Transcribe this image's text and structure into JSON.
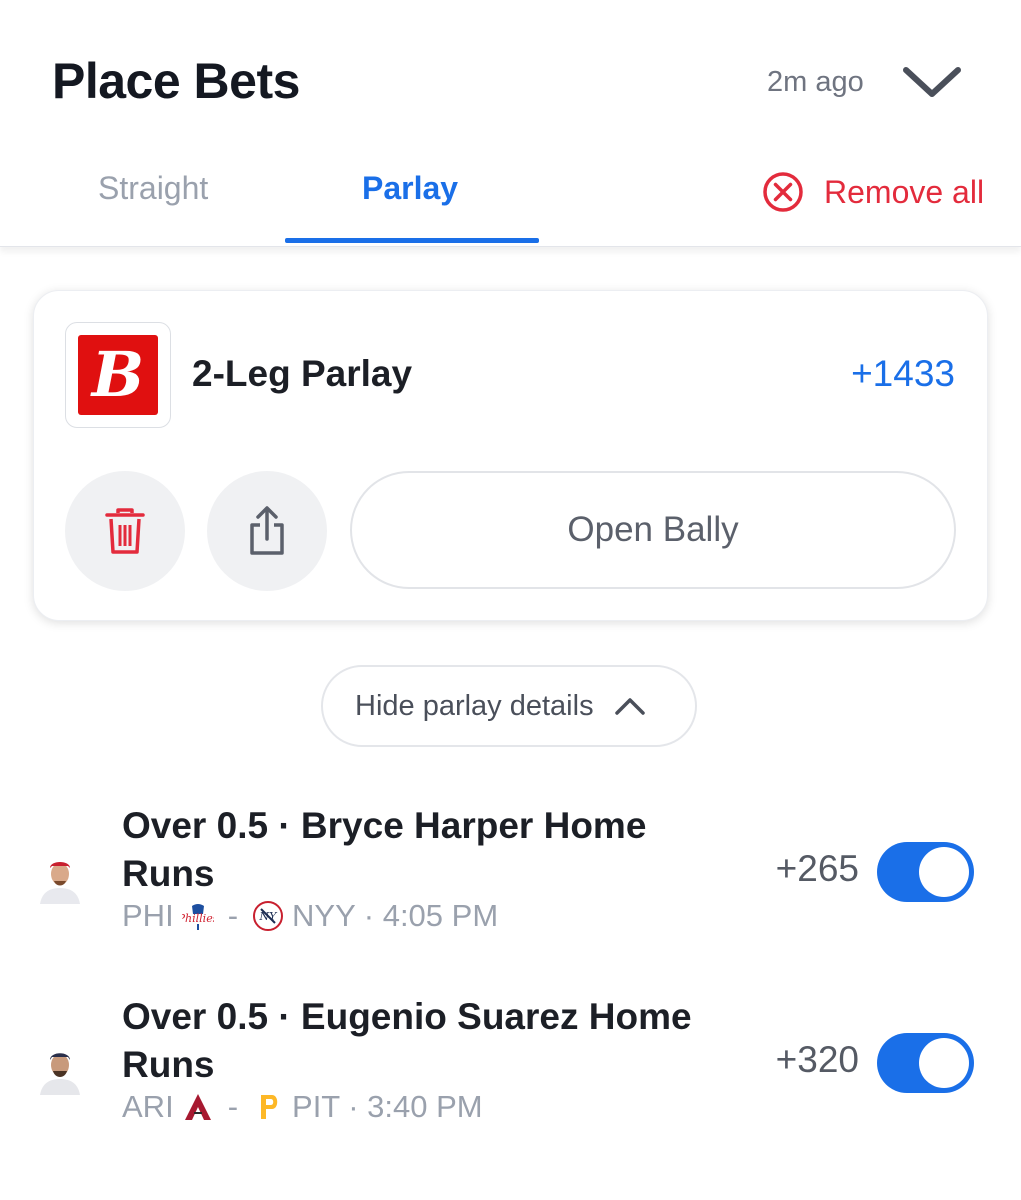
{
  "header": {
    "title": "Place Bets",
    "time_ago": "2m ago"
  },
  "tabs": [
    {
      "label": "Straight"
    },
    {
      "label": "Parlay"
    }
  ],
  "active_tab": "Parlay",
  "remove_all_label": "Remove all",
  "parlay": {
    "book": "Bally",
    "logo_letter": "B",
    "name": "2-Leg Parlay",
    "odds": "+1433",
    "open_label": "Open Bally"
  },
  "hide_details_label": "Hide parlay details",
  "legs": [
    {
      "title": "Over 0.5 · Bryce Harper Home Runs",
      "away": "PHI",
      "separator": "-",
      "home": "NYY",
      "time": "· 4:05 PM",
      "odds": "+265",
      "enabled": true
    },
    {
      "title": "Over 0.5 · Eugenio Suarez Home Runs",
      "away": "ARI",
      "separator": "-",
      "home": "PIT",
      "time": "· 3:40 PM",
      "odds": "+320",
      "enabled": true
    }
  ],
  "colors": {
    "accent": "#1a6fe8",
    "danger": "#e32b3c",
    "bally_red": "#e01010"
  }
}
